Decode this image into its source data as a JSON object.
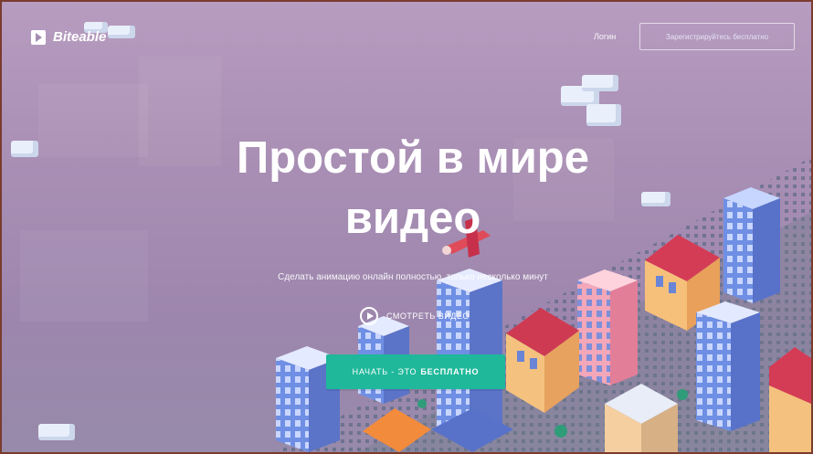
{
  "brand": {
    "name": "Biteable"
  },
  "nav": {
    "login": "Логин",
    "signup": "Зарегистрируйтесь бесплатно"
  },
  "hero": {
    "title_line1": "Простой в мире",
    "title_line2": "видео",
    "subtitle": "Сделать анимацию онлайн полностью, только несколько минут",
    "watch_label": "СМОТРЕТЬ ВИДЕО",
    "cta_prefix": "НАЧАТЬ - ЭТО",
    "cta_strong": "БЕСПЛАТНО"
  },
  "colors": {
    "background": "#a98fb4",
    "accent": "#1fb89a",
    "border": "#7a3b2e"
  },
  "icons": [
    "logo-play-icon",
    "play-circle-icon"
  ]
}
